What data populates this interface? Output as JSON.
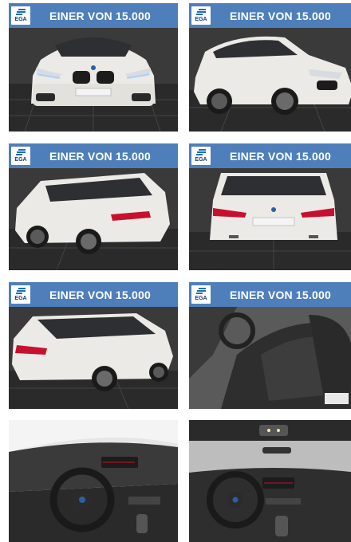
{
  "badge_text": "EGA",
  "headline": "EINER VON 15.000",
  "colors": {
    "banner": "#4f7fba",
    "car_white": "#eceae6",
    "floor": "#2d2d2d",
    "taillight": "#c8102e"
  },
  "gallery": [
    {
      "view": "front"
    },
    {
      "view": "front-three-quarter"
    },
    {
      "view": "rear-three-quarter-left"
    },
    {
      "view": "rear"
    },
    {
      "view": "rear-three-quarter-right"
    },
    {
      "view": "front-seats"
    },
    {
      "view": "cockpit-left"
    },
    {
      "view": "cockpit-center"
    }
  ]
}
